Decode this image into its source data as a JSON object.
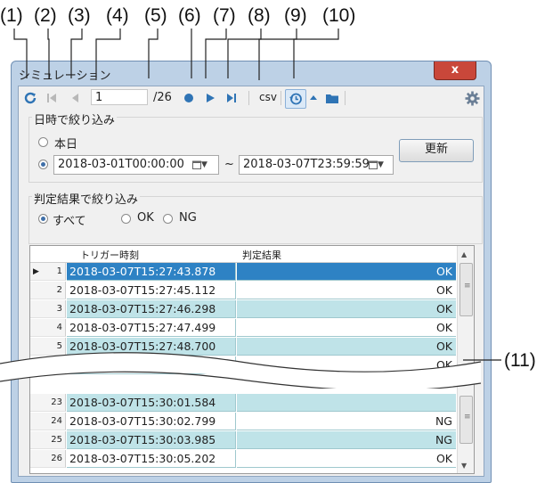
{
  "callouts": [
    "(1)",
    "(2)",
    "(3)",
    "(4)",
    "(5)",
    "(6)",
    "(7)",
    "(8)",
    "(9)",
    "(10)",
    "(11)"
  ],
  "window": {
    "title": "シミュレーション",
    "close_label": "x"
  },
  "toolbar": {
    "page_current": "1",
    "page_total": "/26",
    "csv_label": "csv"
  },
  "date_filter": {
    "group_label": "日時で絞り込み",
    "today_label": "本日",
    "selected": "range",
    "from_value": "2018-03-01T00:00:00",
    "tilde": "~",
    "to_value": "2018-03-07T23:59:59",
    "update_label": "更新"
  },
  "result_filter": {
    "group_label": "判定結果で絞り込み",
    "options": [
      "すべて",
      "OK",
      "NG"
    ],
    "selected": "すべて"
  },
  "table": {
    "columns": [
      "トリガー時刻",
      "判定結果"
    ],
    "rows": [
      {
        "n": "1",
        "time": "2018-03-07T15:27:43.878",
        "result": "OK"
      },
      {
        "n": "2",
        "time": "2018-03-07T15:27:45.112",
        "result": "OK"
      },
      {
        "n": "3",
        "time": "2018-03-07T15:27:46.298",
        "result": "OK"
      },
      {
        "n": "4",
        "time": "2018-03-07T15:27:47.499",
        "result": "OK"
      },
      {
        "n": "5",
        "time": "2018-03-07T15:27:48.700",
        "result": "OK"
      },
      {
        "n": "",
        "time": "",
        "result": "OK"
      },
      {
        "n": "23",
        "time": "2018-03-07T15:30:01.584",
        "result": ""
      },
      {
        "n": "24",
        "time": "2018-03-07T15:30:02.799",
        "result": "NG"
      },
      {
        "n": "25",
        "time": "2018-03-07T15:30:03.985",
        "result": "NG"
      },
      {
        "n": "26",
        "time": "2018-03-07T15:30:05.202",
        "result": "OK"
      }
    ]
  },
  "colors": {
    "accent": "#2e82c4",
    "row_alt": "#bfe3e8",
    "window_frame": "#bdd1e6",
    "close": "#c9473a"
  }
}
